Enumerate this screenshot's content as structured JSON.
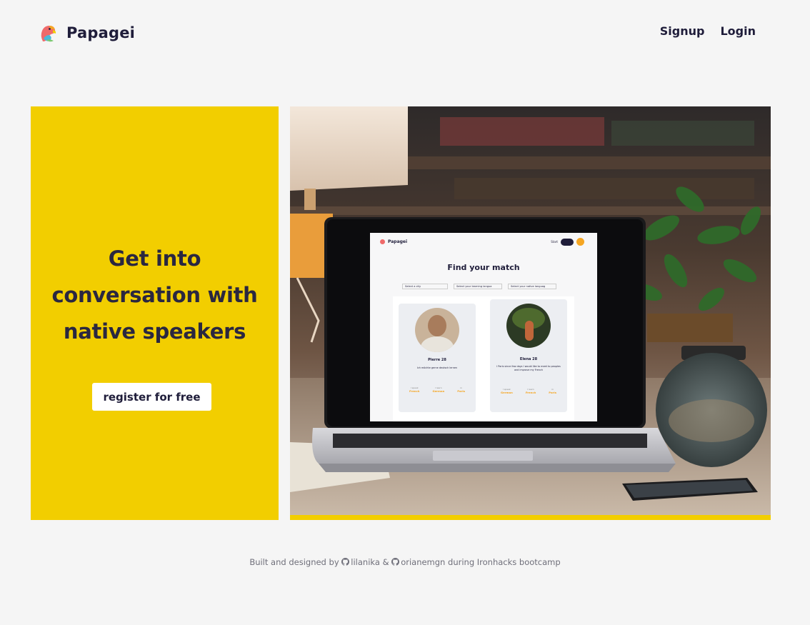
{
  "header": {
    "brand_name": "Papagei",
    "nav": {
      "signup_label": "Signup",
      "login_label": "Login"
    }
  },
  "hero": {
    "title_lines": [
      "Get into",
      "conversation with",
      "native speakers"
    ],
    "register_label": "register for free"
  },
  "mockup": {
    "brand_name": "Papagei",
    "nav_label": "Start",
    "heading": "Find your match",
    "filters": [
      "Select a city",
      "Select your learning langua",
      "Select your native languag"
    ],
    "cards": [
      {
        "name": "Pierre 28",
        "bio": "Ich möchte gerne deutsch lernen",
        "stats": [
          {
            "label": "I speak",
            "value": "French"
          },
          {
            "label": "I learn",
            "value": "German"
          },
          {
            "label": "in",
            "value": "Paris"
          }
        ]
      },
      {
        "name": "Elena 28",
        "bio": "I Paris since few days I would like to meet to peoples and improve my French",
        "stats": [
          {
            "label": "I speak",
            "value": "German"
          },
          {
            "label": "I learn",
            "value": "French"
          },
          {
            "label": "in",
            "value": "Paris"
          }
        ]
      }
    ]
  },
  "footer": {
    "prefix": "Built and designed by",
    "author1": "lilanika",
    "amp": "&",
    "author2": "orianemgn",
    "suffix": "during Ironhacks bootcamp"
  },
  "colors": {
    "brand_yellow": "#f2ce00",
    "text_dark": "#1f1d3a",
    "background": "#f5f5f5",
    "accent_orange": "#f5a623"
  },
  "icons": {
    "brand": "parrot-logo-icon",
    "github": "github-icon"
  }
}
